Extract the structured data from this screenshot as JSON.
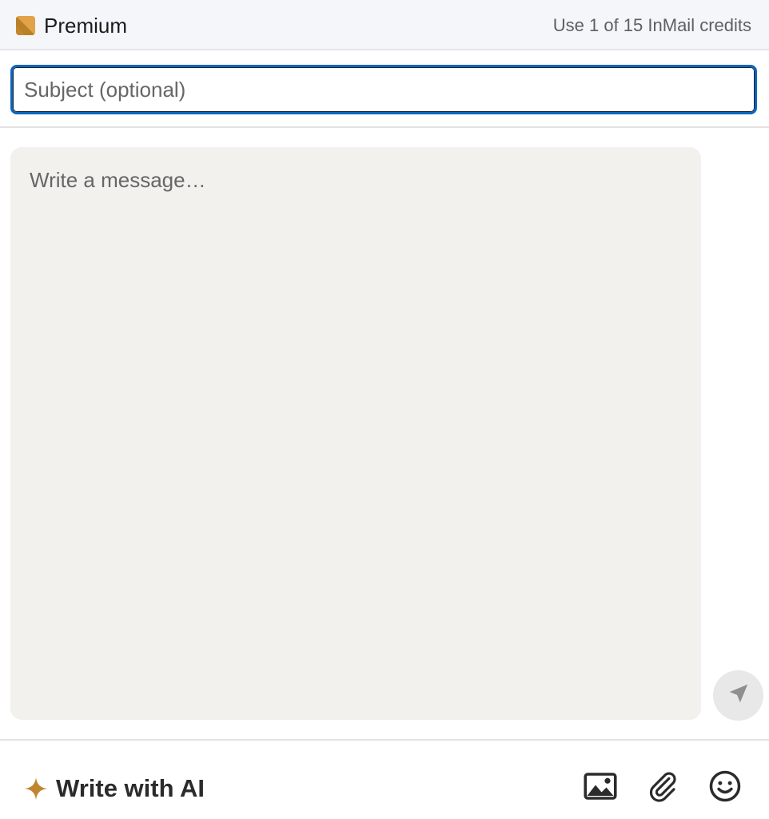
{
  "header": {
    "premium_label": "Premium",
    "credits_text": "Use 1 of 15 InMail credits",
    "badge_colors": [
      "#c2872c",
      "#e0a84a"
    ]
  },
  "subject": {
    "placeholder": "Subject (optional)",
    "value": ""
  },
  "message": {
    "placeholder": "Write a message…",
    "value": ""
  },
  "send": {
    "icon": "send-icon"
  },
  "footer": {
    "ai_label": "Write with AI",
    "ai_icon": "sparkle-icon",
    "ai_color": "#c0852f",
    "tools": [
      "image-icon",
      "paperclip-icon",
      "emoji-icon"
    ]
  },
  "colors": {
    "accent": "#0a66c2",
    "message_bg": "#f2f1ee",
    "header_bg": "#f4f6fa"
  }
}
